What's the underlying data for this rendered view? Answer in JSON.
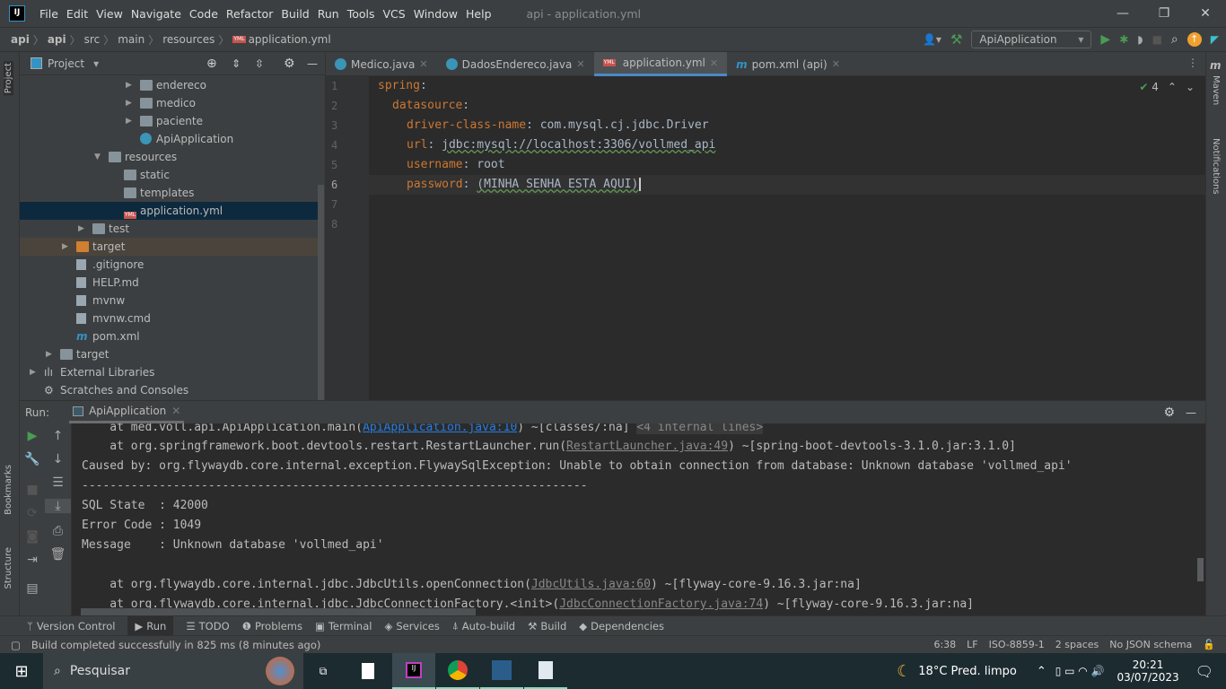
{
  "window": {
    "title": "api - application.yml",
    "minimize": "—",
    "maximize": "❐",
    "close": "✕"
  },
  "menu": [
    "File",
    "Edit",
    "View",
    "Navigate",
    "Code",
    "Refactor",
    "Build",
    "Run",
    "Tools",
    "VCS",
    "Window",
    "Help"
  ],
  "breadcrumb": [
    "api",
    "api",
    "src",
    "main",
    "resources",
    "application.yml"
  ],
  "toolbar": {
    "run_config": "ApiApplication"
  },
  "project": {
    "title": "Project",
    "items": [
      {
        "label": "endereco",
        "type": "folder"
      },
      {
        "label": "medico",
        "type": "folder"
      },
      {
        "label": "paciente",
        "type": "folder"
      },
      {
        "label": "ApiApplication",
        "type": "class"
      },
      {
        "label": "resources",
        "type": "folder"
      },
      {
        "label": "static",
        "type": "folder"
      },
      {
        "label": "templates",
        "type": "folder"
      },
      {
        "label": "application.yml",
        "type": "yml"
      },
      {
        "label": "test",
        "type": "folder"
      },
      {
        "label": "target",
        "type": "folder-orange"
      },
      {
        "label": ".gitignore",
        "type": "file"
      },
      {
        "label": "HELP.md",
        "type": "file"
      },
      {
        "label": "mvnw",
        "type": "file"
      },
      {
        "label": "mvnw.cmd",
        "type": "file"
      },
      {
        "label": "pom.xml",
        "type": "maven"
      },
      {
        "label": "target",
        "type": "folder"
      },
      {
        "label": "External Libraries",
        "type": "lib"
      },
      {
        "label": "Scratches and Consoles",
        "type": "scratch"
      }
    ]
  },
  "editor": {
    "tabs": [
      {
        "label": "Medico.java"
      },
      {
        "label": "DadosEndereco.java"
      },
      {
        "label": "application.yml",
        "active": true
      },
      {
        "label": "pom.xml (api)"
      }
    ],
    "inspections": "4",
    "lines": [
      {
        "n": "1",
        "key": "spring",
        "val": ""
      },
      {
        "n": "2",
        "key": "datasource",
        "val": ""
      },
      {
        "n": "3",
        "key": "driver-class-name",
        "val": "com.mysql.cj.jdbc.Driver"
      },
      {
        "n": "4",
        "key": "url",
        "val": "jdbc:mysql://localhost:3306/vollmed_api"
      },
      {
        "n": "5",
        "key": "username",
        "val": "root"
      },
      {
        "n": "6",
        "key": "password",
        "val": "(MINHA SENHA ESTA AQUI)"
      },
      {
        "n": "7",
        "key": "",
        "val": ""
      },
      {
        "n": "8",
        "key": "",
        "val": ""
      }
    ]
  },
  "run": {
    "label": "Run:",
    "tab": "ApiApplication",
    "console": {
      "l1a": "    at med.voll.api.ApiApplication.main(",
      "l1link": "ApiApplication.java:10",
      "l1b": ") ~[classes/:na] ",
      "l1fold": "<4 internal lines>",
      "l2a": "    at org.springframework.boot.devtools.restart.RestartLauncher.run(",
      "l2link": "RestartLauncher.java:49",
      "l2b": ") ~[spring-boot-devtools-3.1.0.jar:3.1.0]",
      "l3": "Caused by: org.flywaydb.core.internal.exception.FlywaySqlException: Unable to obtain connection from database: Unknown database 'vollmed_api'",
      "l4": "------------------------------------------------------------------------",
      "l5": "SQL State  : 42000",
      "l6": "Error Code : 1049",
      "l7": "Message    : Unknown database 'vollmed_api'",
      "l8a": "    at org.flywaydb.core.internal.jdbc.JdbcUtils.openConnection(",
      "l8link": "JdbcUtils.java:60",
      "l8b": ") ~[flyway-core-9.16.3.jar:na]",
      "l9a": "    at org.flywaydb.core.internal.jdbc.JdbcConnectionFactory.<init>(",
      "l9link": "JdbcConnectionFactory.java:74",
      "l9b": ") ~[flyway-core-9.16.3.jar:na]"
    }
  },
  "side": {
    "project": "Project",
    "bookmarks": "Bookmarks",
    "structure": "Structure",
    "maven": "Maven",
    "notifications": "Notifications"
  },
  "bottom_tabs": [
    "Version Control",
    "Run",
    "TODO",
    "Problems",
    "Terminal",
    "Services",
    "Auto-build",
    "Build",
    "Dependencies"
  ],
  "status": {
    "message": "Build completed successfully in 825 ms (8 minutes ago)",
    "position": "6:38",
    "line_sep": "LF",
    "encoding": "ISO-8859-1",
    "indent": "2 spaces",
    "schema": "No JSON schema"
  },
  "taskbar": {
    "search": "Pesquisar",
    "weather": "18°C  Pred. limpo",
    "time": "20:21",
    "date": "03/07/2023"
  },
  "colors": {
    "accent": "#4a88c7",
    "run_green": "#499c54",
    "keyword": "#cc7832",
    "link": "#287bde"
  }
}
